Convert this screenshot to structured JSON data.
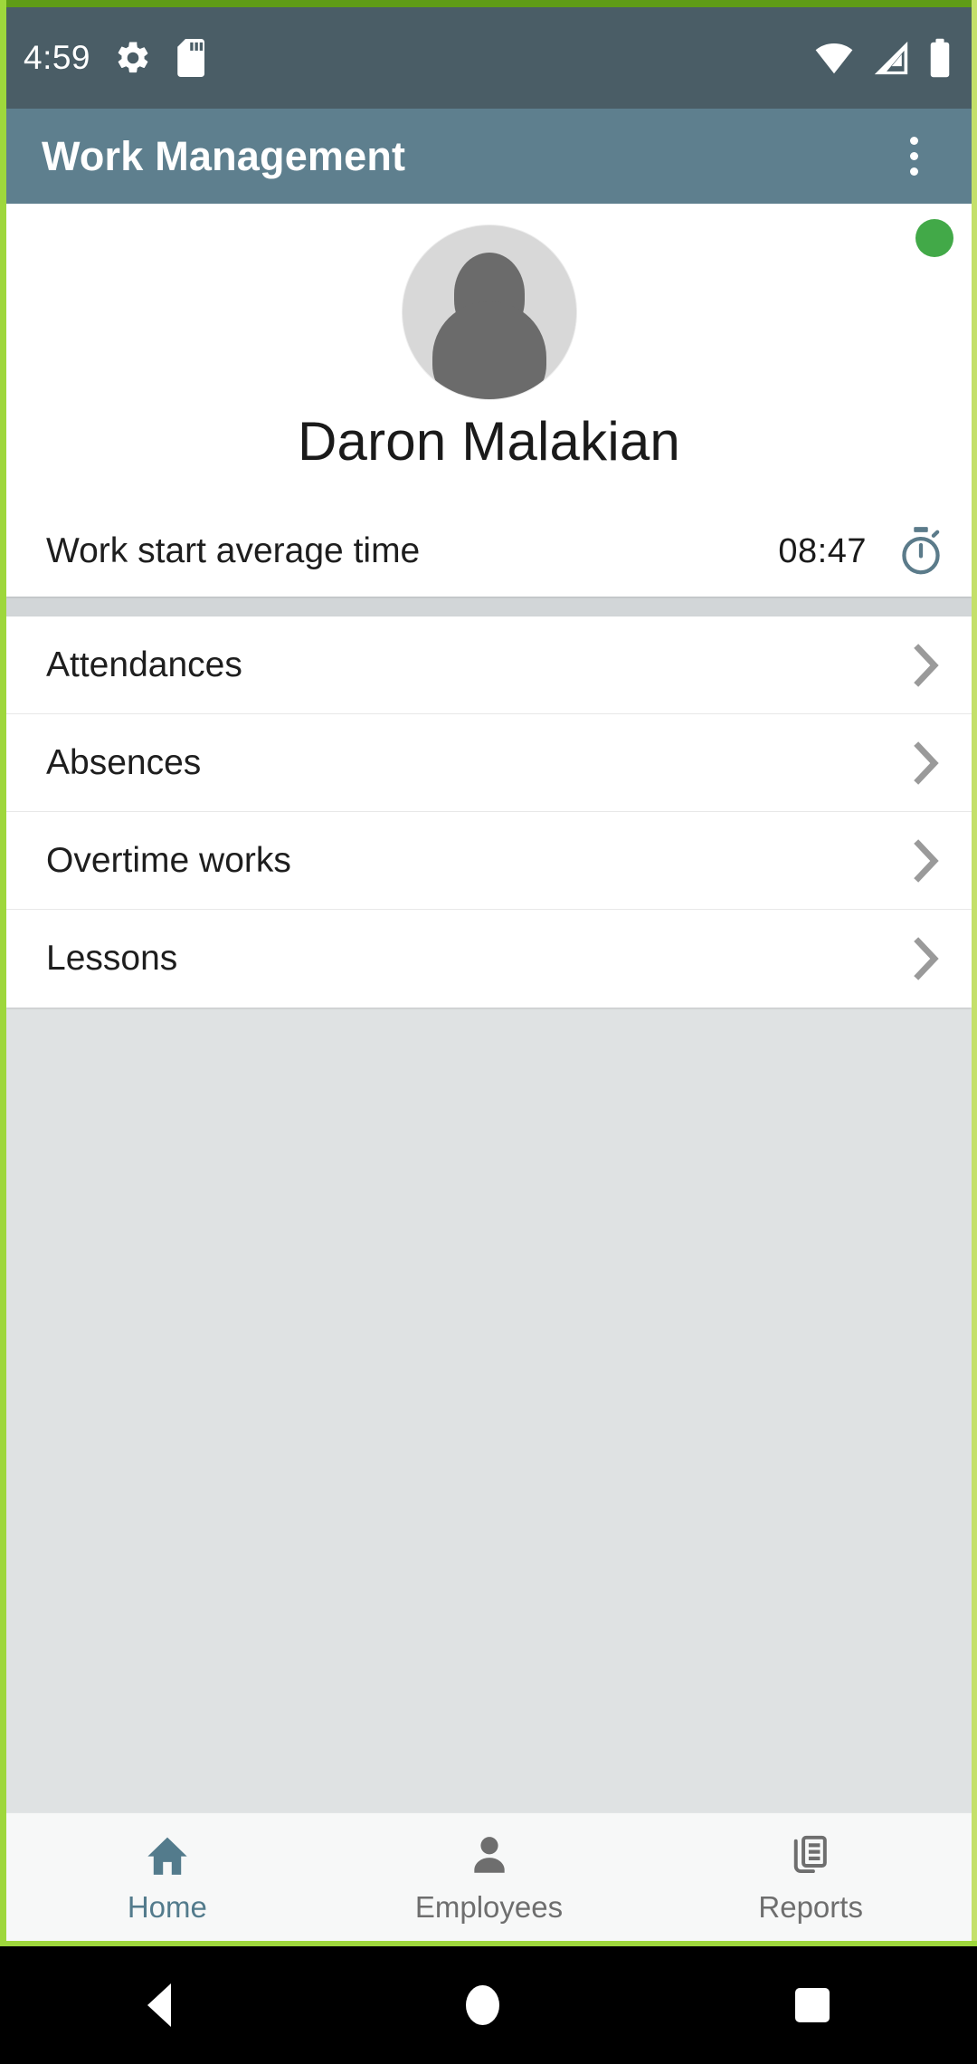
{
  "status_bar": {
    "time": "4:59",
    "icons_left": [
      "gear-icon",
      "sd-card-icon"
    ],
    "icons_right": [
      "wifi-icon",
      "cellular-signal-icon",
      "battery-icon"
    ],
    "background_color": "#4a5d66"
  },
  "app_bar": {
    "title": "Work Management",
    "overflow_label": "more-options",
    "background_color": "#5e7f8e"
  },
  "profile": {
    "name": "Daron Malakian",
    "status_color": "#42a948",
    "avatar_icon": "person-placeholder-icon",
    "avg_row": {
      "label": "Work start average time",
      "value": "08:47",
      "icon": "stopwatch-icon",
      "icon_color": "#5b7b8a"
    }
  },
  "menu": {
    "items": [
      {
        "label": "Attendances",
        "chevron": "chevron-right-icon"
      },
      {
        "label": "Absences",
        "chevron": "chevron-right-icon"
      },
      {
        "label": "Overtime works",
        "chevron": "chevron-right-icon"
      },
      {
        "label": "Lessons",
        "chevron": "chevron-right-icon"
      }
    ]
  },
  "bottom_nav": {
    "active_color": "#537b8c",
    "inactive_color": "#6e6e6e",
    "items": [
      {
        "label": "Home",
        "icon": "home-icon",
        "active": true
      },
      {
        "label": "Employees",
        "icon": "person-icon",
        "active": false
      },
      {
        "label": "Reports",
        "icon": "reports-document-icon",
        "active": false
      }
    ]
  },
  "system_nav": {
    "back": "back-triangle-icon",
    "home": "home-circle-icon",
    "recents": "recents-square-icon"
  },
  "frame": {
    "accent_color": "#9ed73c"
  }
}
